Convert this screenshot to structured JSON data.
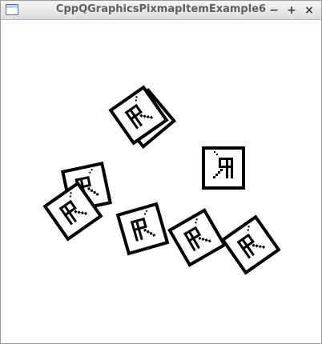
{
  "window": {
    "title": "CppQGraphicsPixmapItemExample6",
    "minimize_glyph": "−",
    "maximize_glyph": "+",
    "close_glyph": "×"
  },
  "scene": {
    "item_icon": "R-letter-pixmap-icon",
    "item_count": 8
  }
}
